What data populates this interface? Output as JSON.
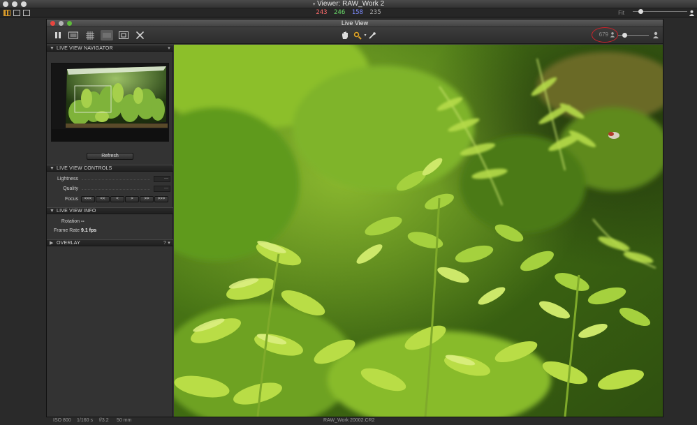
{
  "outer": {
    "title": "Viewer: RAW_Work 2",
    "rgb": {
      "r": "243",
      "g": "246",
      "b": "158",
      "a": "235"
    },
    "fit_label": "Fit"
  },
  "live_view": {
    "title": "Live View",
    "exposure_value": "679"
  },
  "panel": {
    "navigator": {
      "header": "Live View Navigator",
      "refresh_label": "Refresh"
    },
    "controls": {
      "header": "Live View Controls",
      "lightness_label": "Lightness",
      "lightness_value": "---",
      "quality_label": "Quality",
      "quality_value": "---",
      "focus_label": "Focus",
      "focus_buttons": [
        "<<<",
        "<<",
        "<",
        ">",
        ">>",
        ">>>"
      ]
    },
    "info": {
      "header": "Live View Info",
      "rotation_label": "Rotation",
      "rotation_value": "--",
      "frame_rate_label": "Frame Rate",
      "frame_rate_value": "9.1 fps"
    },
    "overlay": {
      "header": "Overlay",
      "help": "?"
    }
  },
  "status": {
    "iso": "ISO 800",
    "shutter": "1/160 s",
    "aperture": "f/3.2",
    "focal": "50 mm",
    "filename": "RAW_Work 20002.CR2"
  },
  "colors": {
    "accent": "#d0232a",
    "red": "#ff6b6b",
    "green": "#6bdc6b",
    "blue": "#7d8cff"
  }
}
